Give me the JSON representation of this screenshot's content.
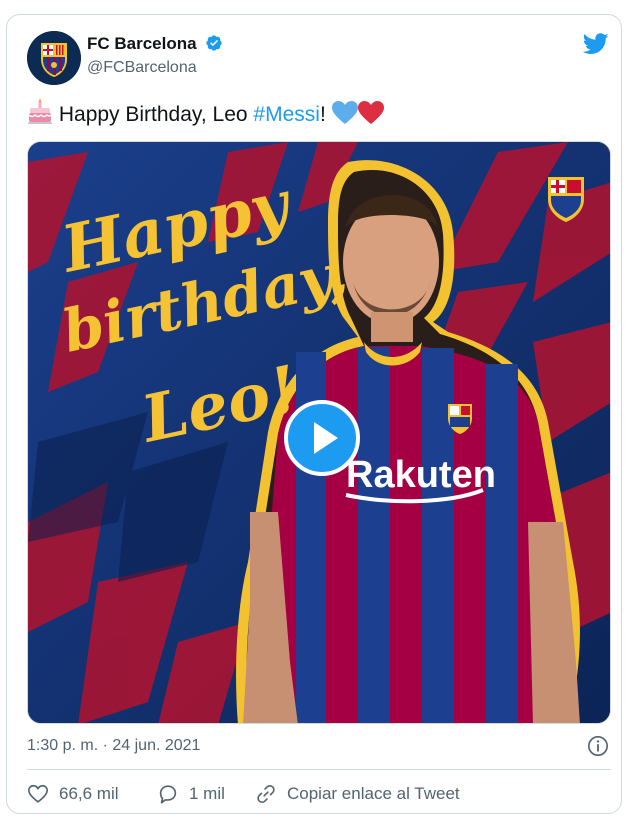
{
  "author": {
    "name": "FC Barcelona",
    "handle": "@FCBarcelona"
  },
  "tweet": {
    "text_before": "Happy Birthday, Leo ",
    "hashtag": "#Messi",
    "text_after": "!",
    "emojis": [
      "birthday-cake",
      "blue-heart",
      "red-heart"
    ]
  },
  "media": {
    "type": "video",
    "overlay_text": [
      "Happy",
      "birthday,",
      "Leo!"
    ],
    "shirt_sponsor": "Rakuten"
  },
  "meta": {
    "timestamp": "1:30 p. m. · 24 jun. 2021"
  },
  "actions": {
    "likes": "66,6 mil",
    "replies": "1 mil",
    "copy_link": "Copiar enlace al Tweet"
  },
  "colors": {
    "accent": "#1d9bf0",
    "text": "#0f1419",
    "muted": "#536471",
    "border": "#cfd9de",
    "barca_blue": "#0d2a6b",
    "barca_red": "#a50044",
    "barca_yellow": "#f2c230"
  }
}
